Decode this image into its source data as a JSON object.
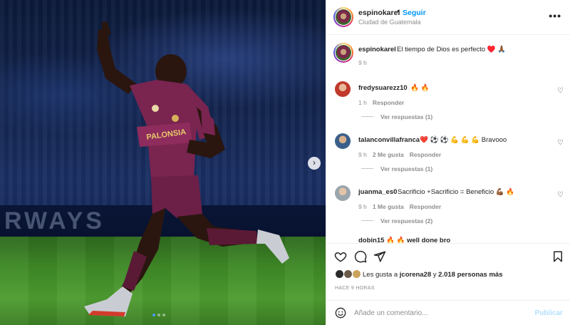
{
  "photo": {
    "ad_text": "RWAYS",
    "next_icon": "chevron-right-icon",
    "carousel_dots": 3,
    "carousel_active": 0
  },
  "header": {
    "username": "espinokarel",
    "separator": "•",
    "follow_label": "Seguir",
    "location": "Ciudad de Guatemala",
    "more_icon": "more-horizontal-icon",
    "more_glyph": "•••"
  },
  "caption": {
    "username": "espinokarel",
    "text": "El tiempo de Dios es perfecto ♥️ 🙏🏾",
    "time": "9 h"
  },
  "comments": [
    {
      "username": "fredysuarezz10",
      "text": "🔥 🔥",
      "time": "1 h",
      "likes": "",
      "reply_label": "Responder",
      "replies": "Ver respuestas (1)",
      "avatar_color": "#c0392b"
    },
    {
      "username": "talanconvillafranca",
      "text": "❤️ ⚽ ⚽ 💪 💪 💪 Bravooo",
      "time": "9 h",
      "likes": "2 Me gusta",
      "reply_label": "Responder",
      "replies": "Ver respuestas (1)",
      "avatar_color": "#3a5f8a"
    },
    {
      "username": "juanma_es0",
      "text": "Sacrificio +Sacrificio = Beneficio 💪🏾 🔥",
      "time": "9 h",
      "likes": "1 Me gusta",
      "reply_label": "Responder",
      "replies": "Ver respuestas (2)",
      "avatar_color": "#9aa5ad"
    }
  ],
  "partial_comment": "dobin15 🔥 🔥 well done bro",
  "likes": {
    "prefix": "Les gusta a",
    "user": "jcorena28",
    "middle": "y",
    "count": "2.018 personas más"
  },
  "posted": "HACE 9 HORAS",
  "composer": {
    "placeholder": "Añade un comentario...",
    "publish_label": "Publicar"
  },
  "colors": {
    "accent": "#0095f6",
    "publish_disabled": "#b2dffc",
    "kit": "#7a2450"
  }
}
